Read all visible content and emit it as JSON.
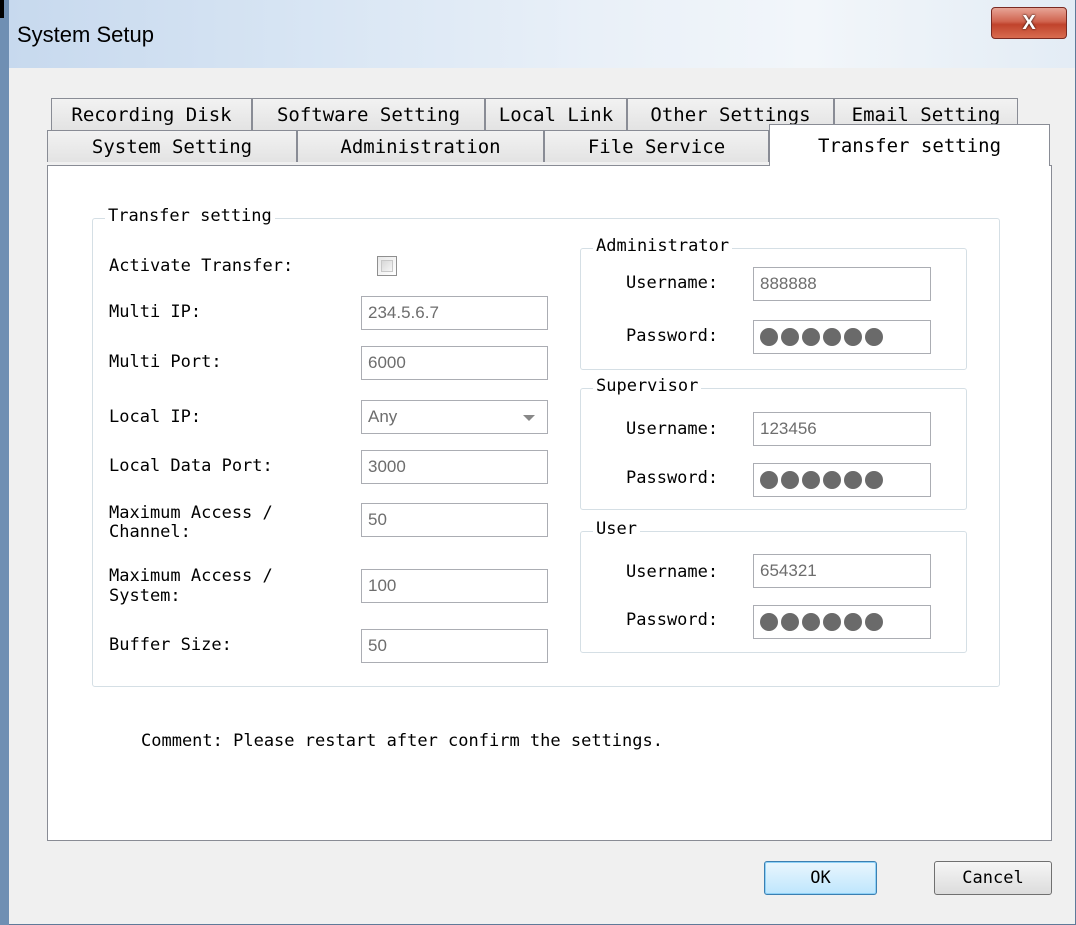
{
  "window": {
    "title": "System Setup",
    "close_glyph": "X"
  },
  "tabs": {
    "row1": [
      "Recording Disk",
      "Software Setting",
      "Local Link",
      "Other Settings",
      "Email Setting"
    ],
    "row2": [
      "System Setting",
      "Administration",
      "File Service",
      "Transfer setting"
    ],
    "active": "Transfer setting"
  },
  "transfer": {
    "legend": "Transfer setting",
    "activate_label": "Activate Transfer:",
    "activate_checked": false,
    "multi_ip_label": "Multi IP:",
    "multi_ip_value": "234.5.6.7",
    "multi_port_label": "Multi Port:",
    "multi_port_value": "6000",
    "local_ip_label": "Local IP:",
    "local_ip_value": "Any",
    "local_data_port_label": "Local Data Port:",
    "local_data_port_value": "3000",
    "max_channel_label_1": "Maximum Access /",
    "max_channel_label_2": "Channel:",
    "max_channel_value": "50",
    "max_system_label_1": "Maximum Access /",
    "max_system_label_2": "System:",
    "max_system_value": "100",
    "buffer_label": "Buffer Size:",
    "buffer_value": "50"
  },
  "accounts": {
    "username_label": "Username:",
    "password_label": "Password:",
    "administrator": {
      "legend": "Administrator",
      "username": "888888",
      "password_dots": 6
    },
    "supervisor": {
      "legend": "Supervisor",
      "username": "123456",
      "password_dots": 6
    },
    "user": {
      "legend": "User",
      "username": "654321",
      "password_dots": 6
    }
  },
  "comment": "Comment: Please restart after confirm the settings.",
  "buttons": {
    "ok": "OK",
    "cancel": "Cancel"
  },
  "icons": {
    "close": "close-icon",
    "dropdown": "chevron-down-icon",
    "checkbox": "checkbox"
  }
}
